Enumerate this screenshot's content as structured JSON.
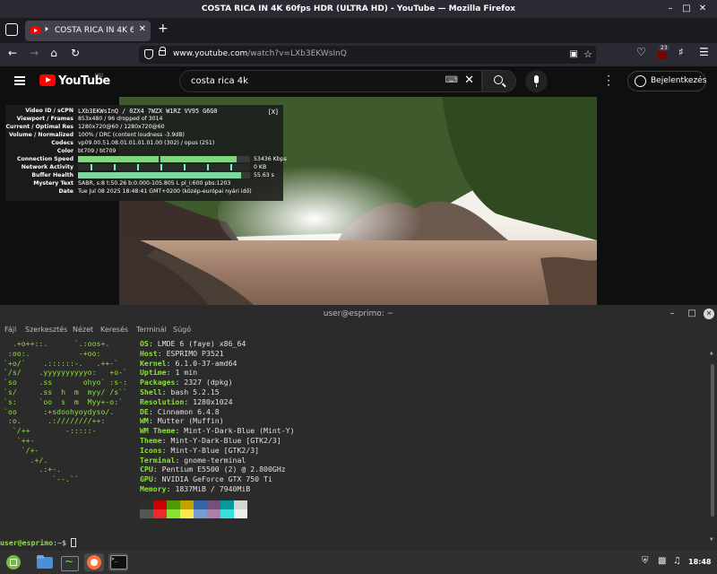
{
  "firefox": {
    "window_title": "COSTA RICA IN 4K 60fps HDR (ULTRA HD) - YouTube — Mozilla Firefox",
    "tab_title": "COSTA RICA IN 4K 60fps HD",
    "url_host": "www.youtube.com",
    "url_path": "/watch?v=LXb3EKWsInQ",
    "extension_badge": "23"
  },
  "youtube": {
    "logo_text": "YouTube",
    "country_code": "HU",
    "search_value": "costa rica 4k",
    "signin_label": "Bejelentkezés",
    "stats": {
      "close_label": "[X]",
      "rows": [
        {
          "k": "Video ID / sCPN",
          "v": "LXb3EKWsInQ / 0ZX4 7WZX W1RZ VV95 G6G0"
        },
        {
          "k": "Viewport / Frames",
          "v": "853x480 / 96 dropped of 3014"
        },
        {
          "k": "Current / Optimal Res",
          "v": "1280x720@60 / 1280x720@60"
        },
        {
          "k": "Volume / Normalized",
          "v": "100% / DRC (content loudness -3.9dB)"
        },
        {
          "k": "Codecs",
          "v": "vp09.00.51.08.01.01.01.01.00 (302) / opus (251)"
        },
        {
          "k": "Color",
          "v": "bt709 / bt709"
        },
        {
          "k": "Connection Speed",
          "v": "53436 Kbps"
        },
        {
          "k": "Network Activity",
          "v": "0 KB"
        },
        {
          "k": "Buffer Health",
          "v": "55.63 s"
        },
        {
          "k": "Mystery Text",
          "v": "SABR, s:8 t:50.26 b:0.000-105.805 L pl_i:600 pbs:1203"
        },
        {
          "k": "Date",
          "v": "Tue Jul 08 2025 18:48:41 GMT+0200 (közép-európai nyári idő)"
        }
      ],
      "connection_fill": 0.92,
      "buffer_fill": 0.95
    }
  },
  "terminal": {
    "title": "user@esprimo: ~",
    "menu": [
      "Fájl",
      "Szerkesztés",
      "Nézet",
      "Keresés",
      "Terminál",
      "Súgó"
    ],
    "ascii_logo": "  .+o++::.      `.:oos+.\n :oo:.           -+oo:\n`+o/`    .::::::-.   .++-`\n`/s/    .yyyyyyyyyyo:   +o-`\n`so     .ss       ohyo` :s-:\n`s/     .ss  h  m  myy/ /s``\n`s:     `oo  s  m  Myy+-o:`\n`oo      :+sdoohyoydyso/.\n :o.      .:////////++:\n  `/++        -:::::-\n   `++-\n    `/+-\n      .+/.\n        .:+-.\n           `--.``",
    "info": [
      {
        "label": "OS",
        "value": "LMDE 6 (faye) x86_64"
      },
      {
        "label": "Host",
        "value": "ESPRIMO P3521"
      },
      {
        "label": "Kernel",
        "value": "6.1.0-37-amd64"
      },
      {
        "label": "Uptime",
        "value": "1 min"
      },
      {
        "label": "Packages",
        "value": "2327 (dpkg)"
      },
      {
        "label": "Shell",
        "value": "bash 5.2.15"
      },
      {
        "label": "Resolution",
        "value": "1280x1024"
      },
      {
        "label": "DE",
        "value": "Cinnamon 6.4.8"
      },
      {
        "label": "WM",
        "value": "Mutter (Muffin)"
      },
      {
        "label": "WM Theme",
        "value": "Mint-Y-Dark-Blue (Mint-Y)"
      },
      {
        "label": "Theme",
        "value": "Mint-Y-Dark-Blue [GTK2/3]"
      },
      {
        "label": "Icons",
        "value": "Mint-Y-Blue [GTK2/3]"
      },
      {
        "label": "Terminal",
        "value": "gnome-terminal"
      },
      {
        "label": "CPU",
        "value": "Pentium E5500 (2) @ 2.800GHz"
      },
      {
        "label": "GPU",
        "value": "NVIDIA GeForce GTX 750 Ti"
      },
      {
        "label": "Memory",
        "value": "1837MiB / 7940MiB"
      }
    ],
    "palette_top": [
      "#2e2e2e",
      "#cc0000",
      "#4e9a06",
      "#c4a000",
      "#3465a4",
      "#75507b",
      "#06989a",
      "#d3d7cf"
    ],
    "palette_bottom": [
      "#555753",
      "#ef2929",
      "#8ae234",
      "#fce94f",
      "#729fcf",
      "#ad7fa8",
      "#34e2e2",
      "#eeeeec"
    ],
    "prompt_user": "user@esprimo",
    "prompt_rest": ":~$ "
  },
  "taskbar": {
    "clock": "18:48"
  }
}
